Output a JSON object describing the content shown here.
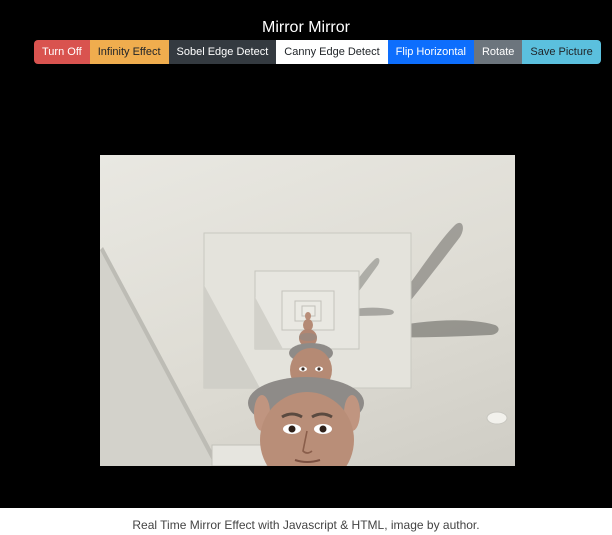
{
  "app": {
    "title": "Mirror Mirror"
  },
  "toolbar": {
    "buttons": [
      {
        "label": "Turn Off",
        "color": "#d9534f"
      },
      {
        "label": "Infinity Effect",
        "color": "#f0ad4e"
      },
      {
        "label": "Sobel Edge Detect",
        "color": "#343a40"
      },
      {
        "label": "Canny Edge Detect",
        "color": "#ffffff"
      },
      {
        "label": "Flip Horizontal",
        "color": "#0d6efd"
      },
      {
        "label": "Rotate",
        "color": "#6c757d"
      },
      {
        "label": "Save Picture",
        "color": "#5bc0de"
      }
    ]
  },
  "video": {
    "effect": "infinity-mirror"
  },
  "caption": "Real Time Mirror Effect with Javascript & HTML, image by author."
}
